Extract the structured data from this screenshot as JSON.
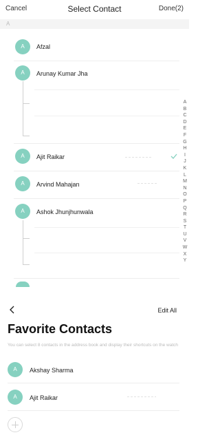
{
  "header": {
    "cancel": "Cancel",
    "title": "Select Contact",
    "done": "Done(2)"
  },
  "section_letter": "A",
  "contacts": [
    {
      "initial": "A",
      "name": "Afzal",
      "selected": false
    },
    {
      "initial": "A",
      "name": "Arunay Kumar Jha",
      "selected": false
    },
    {
      "initial": "A",
      "name": "Ajit Raikar",
      "selected": true
    },
    {
      "initial": "A",
      "name": "Arvind Mahajan",
      "selected": false
    },
    {
      "initial": "A",
      "name": "Ashok Jhunjhunwala",
      "selected": false
    }
  ],
  "alphabet_index": [
    "A",
    "B",
    "C",
    "D",
    "E",
    "F",
    "G",
    "H",
    "I",
    "J",
    "K",
    "L",
    "M",
    "N",
    "O",
    "P",
    "Q",
    "R",
    "S",
    "T",
    "U",
    "V",
    "W",
    "X",
    "Y"
  ],
  "favorites": {
    "edit_all": "Edit All",
    "title": "Favorite Contacts",
    "description": "You can select 8 contacts in the address book and display their shortcuts on the watch",
    "items": [
      {
        "initial": "A",
        "name": "Akshay Sharma"
      },
      {
        "initial": "A",
        "name": "Ajit Raikar"
      }
    ]
  },
  "icons": [
    "back-icon",
    "checkmark-icon",
    "add-icon"
  ],
  "colors": {
    "avatar": "#86d1c0",
    "check": "#86d1c0"
  }
}
